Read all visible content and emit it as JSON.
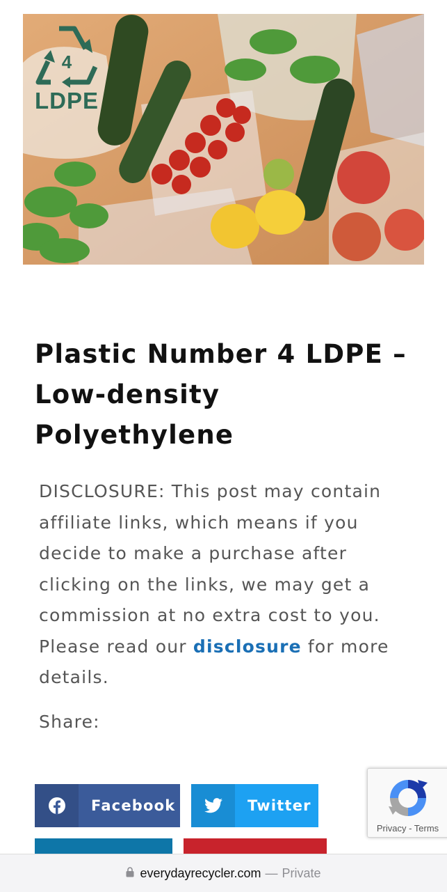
{
  "hero": {
    "alt": "Vegetables and fruit in plastic bags",
    "recycle_number": "4",
    "recycle_code": "LDPE"
  },
  "article": {
    "title": "Plastic Number 4 LDPE – Low-density Polyethylene",
    "disclosure_before": "DISCLOSURE: This post may contain affiliate links, which means if you decide to make a purchase after clicking on the links, we may get a commission at no extra cost to you. Please read our ",
    "disclosure_link": "disclosure",
    "disclosure_after": " for more details.",
    "share_label": "Share:"
  },
  "share": {
    "facebook": "Facebook",
    "twitter": "Twitter"
  },
  "recaptcha": {
    "privacy": "Privacy",
    "separator": " - ",
    "terms": "Terms"
  },
  "urlbar": {
    "domain": "everydayrecycler.com",
    "separator": "—",
    "mode": "Private"
  },
  "colors": {
    "facebook": "#3b5b9a",
    "twitter": "#1da1f2",
    "linkedin": "#0e76a8",
    "pinterest": "#c8232c",
    "link": "#1a6fb5"
  }
}
